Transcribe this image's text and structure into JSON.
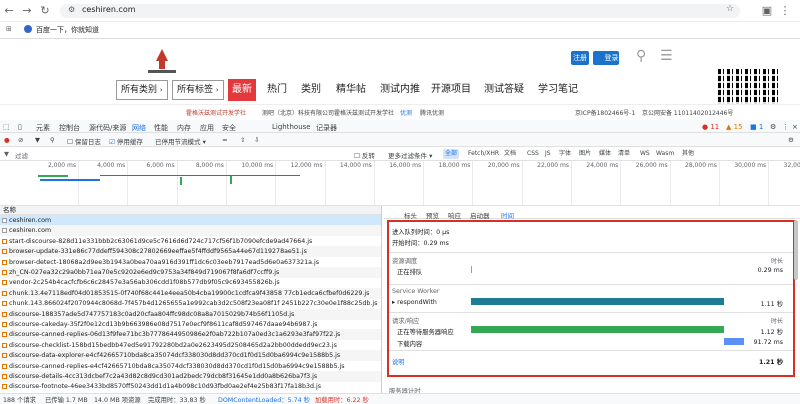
{
  "browser": {
    "url": "ceshiren.com",
    "bookmark": "百度一下，你就知道"
  },
  "site": {
    "nav_selects": [
      "所有类别",
      "所有标签"
    ],
    "latest": "最新",
    "nav_items": [
      "热门",
      "类别",
      "精华帖",
      "测试内推",
      "开源项目",
      "测试答疑",
      "学习笔记"
    ],
    "register": "注册",
    "login": "登录",
    "banner": [
      "霍格沃兹测试开发学社",
      "测吧（北京）科技有限公司",
      "霍格沃兹测试开发学社",
      "优测",
      "腾讯优测",
      "京ICP备1802466号-1",
      "京公网安备 11011402012446号"
    ]
  },
  "devtools": {
    "tabs": [
      "元素",
      "控制台",
      "源代码/来源",
      "网络",
      "性能",
      "内存",
      "应用",
      "安全",
      "Lighthouse",
      "记录器"
    ],
    "active_tab": "网络",
    "counts": {
      "errors": "11",
      "warnings": "15",
      "info": "1"
    },
    "toolbar": {
      "preserve_log": "保留日志",
      "disable_cache": "停用缓存",
      "throttle": "已停用节流模式"
    },
    "filter": {
      "placeholder": "过滤",
      "invert": "反转",
      "more": "更多过滤条件",
      "types": [
        "全部",
        "Fetch/XHR",
        "文档",
        "CSS",
        "JS",
        "字体",
        "图片",
        "媒体",
        "清单",
        "WS",
        "Wasm",
        "其他"
      ],
      "selected": "全部"
    },
    "timeline_ticks": [
      "2,000 ms",
      "4,000 ms",
      "6,000 ms",
      "8,000 ms",
      "10,000 ms",
      "12,000 ms",
      "14,000 ms",
      "16,000 ms",
      "18,000 ms",
      "20,000 ms",
      "22,000 ms",
      "24,000 ms",
      "26,000 ms",
      "28,000 ms",
      "30,000 ms",
      "32,000 ms"
    ],
    "name_header": "名称",
    "requests": [
      "ceshiren.com",
      "ceshiren.com",
      "start-discourse-828d11e331bbb2c63061d9ce5c7616d6d724c717cf56f1b7090efcde9ad47664.js",
      "browser-update-331e86c77ddeff594308c27802669eeffae5f4ffddf9565a44e67d119278ae51.js",
      "browser-detect-18068a2d9ee3b1943a0bea70aa916d391ff1dc6c03eeb7917ead5d6e0a637321a.js",
      "zh_CN-027ea32c29a0bb71ea70e5c9202e6ed9c9753a34f849d719067f8fa6df7ccff9.js",
      "vendor-2c254b4cacfcfb6c6c28457e3a56ab306cdd1f08b577db9f05c9c693455826b.js",
      "chunk.13.4e7118edf04d01853515-0f740f68c441e4eea50b4cba19900c1cdfca9f43858 77cb1edca6cfbef0d6229.js",
      "chunk.143.866024f2070944c8068d-7f457b4d1265655a1e992cab3d2c508f23ea08f1f 2451b227c30e0e1f88c25db.js",
      "discourse-188357ade5d747757183c0ad20cfaa804ffc98dc08a8a7015029b74b56f1105d.js",
      "discourse-cakeday-35f2f0e12cd13b9b663986e08d7517e0ecf9f8611caf8d597467daae94b6987.js",
      "discourse-canned-replies-06d13f9fee71bc3b7778644950986e2f0ab722b107a0ed3c1a6293e3faf97f22.js",
      "discourse-checklist-158bd15bedbb47ed5e91792280bd2a0e2623495d2508465d2a2bb00ddedd9ec23.js",
      "discourse-data-explorer-e4cf42665710bda8ca35074dcf338030d8dd370cd1f0d15d0ba6994c9e1588b5.js",
      "discourse-canned-replies-e4cf42665710bda8ca35074dcf338030d8dd370cd1f0d15d0ba6994c9e1588b5.js",
      "discourse-details-4cc313dcbef7c2a43d82c8d9cd301ad2bedc79dcb8f31645e1dd0a8b626ba7f3.js",
      "discourse-footnote-46ee3433bd8570ff50243dd1d1a4b098c10d93fbd0ae2ef4e25b83f17fa18b3d.js"
    ],
    "status": {
      "requests": "188 个请求",
      "transferred": "已传输 1.7 MB",
      "resources": "14.0 MB 项资源",
      "finish": "完成用时：33.83 秒",
      "dcl": "DOMContentLoaded：5.74 秒",
      "load": "加载用时：6.22 秒"
    },
    "detail_tabs": [
      "标头",
      "预览",
      "响应",
      "启动器",
      "时间"
    ],
    "detail_active": "时间",
    "timing": {
      "queued_at": "进入队列时间：0 μs",
      "started_at": "开始时间：0.29 ms",
      "resource_scheduling": "资源调度",
      "duration_header": "时长",
      "queueing": {
        "label": "正在排队",
        "value": "0.29 ms"
      },
      "service_worker": "Service Worker",
      "respond_with": {
        "label": "respondWith",
        "value": "1.11 秒"
      },
      "request_response": "请求/响应",
      "waiting": {
        "label": "正在等待服务器响应",
        "value": "1.12 秒"
      },
      "download": {
        "label": "下载内容",
        "value": "91.72 ms"
      },
      "explanation": "说明",
      "total": "1.21 秒",
      "server_timing": "服务器计时"
    },
    "colors": {
      "respond_with": "#1e7d95",
      "waiting": "#34a853",
      "download": "#5b8ff9",
      "highlight": "#d93025",
      "active": "#1a73e8"
    }
  }
}
